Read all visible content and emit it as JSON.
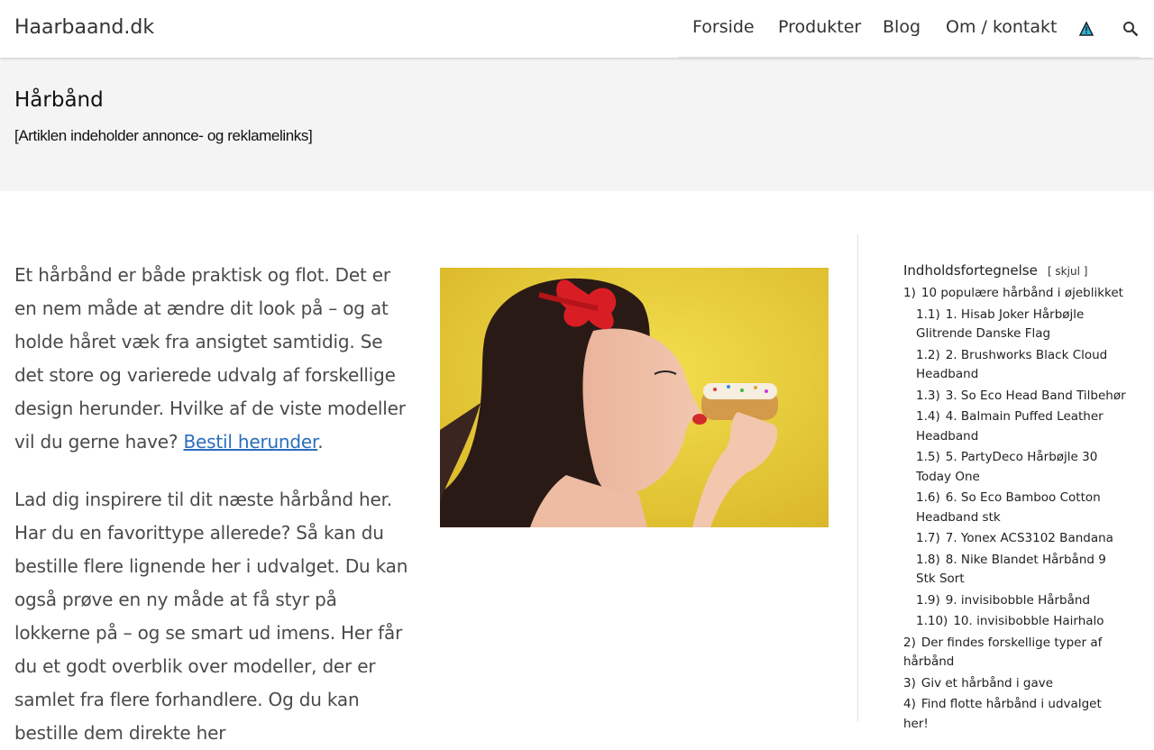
{
  "header": {
    "site_title": "Haarbaand.dk",
    "nav": [
      "Forside",
      "Produkter",
      "Blog",
      "Om / kontakt"
    ],
    "icons": {
      "alert": "warning-triangle-icon",
      "search": "search-icon"
    }
  },
  "page": {
    "title": "Hårbånd",
    "disclaimer": "[Artiklen indeholder annonce- og reklamelinks]"
  },
  "content": {
    "para1_text": "Et hårbånd er både praktisk og flot. Det er en nem måde at ændre dit look på – og at holde håret væk fra ansigtet samtidig. Se det store og varierede udvalg af forskellige design herunder. Hvilke af de viste modeller vil du gerne have? ",
    "para1_link": "Bestil herunder",
    "para1_end": ".",
    "para2": "Lad dig inspirere til dit næste hårbånd her. Har du en favorittype allerede? Så kan du bestille flere lignende her i udvalget. Du kan også prøve en ny måde at få styr på lokkerne på – og se smart ud imens. Her får du et godt overblik over modeller, der er samlet fra flere forhandlere. Og du kan bestille dem direkte her"
  },
  "toc": {
    "heading": "Indholdsfortegnelse",
    "toggle": "[ skjul ]",
    "items": [
      {
        "num": "1)",
        "text": "10 populære hårbånd i øjeblikket",
        "sub": false
      },
      {
        "num": "1.1)",
        "text": "1. Hisab Joker Hårbøjle Glitrende Danske Flag",
        "sub": true
      },
      {
        "num": "1.2)",
        "text": "2. Brushworks Black Cloud Headband",
        "sub": true
      },
      {
        "num": "1.3)",
        "text": "3. So Eco Head Band Tilbehør",
        "sub": true
      },
      {
        "num": "1.4)",
        "text": "4. Balmain Puffed Leather Headband",
        "sub": true
      },
      {
        "num": "1.5)",
        "text": "5. PartyDeco Hårbøjle 30 Today One",
        "sub": true
      },
      {
        "num": "1.6)",
        "text": "6. So Eco Bamboo Cotton Headband stk",
        "sub": true
      },
      {
        "num": "1.7)",
        "text": "7. Yonex ACS3102 Bandana",
        "sub": true
      },
      {
        "num": "1.8)",
        "text": "8. Nike Blandet Hårbånd 9 Stk Sort",
        "sub": true
      },
      {
        "num": "1.9)",
        "text": "9. invisibobble Hårbånd",
        "sub": true
      },
      {
        "num": "1.10)",
        "text": "10. invisibobble Hairhalo",
        "sub": true
      },
      {
        "num": "2)",
        "text": "Der findes forskellige typer af hårbånd",
        "sub": false
      },
      {
        "num": "3)",
        "text": "Giv et hårbånd i gave",
        "sub": false
      },
      {
        "num": "4)",
        "text": "Find flotte hårbånd i udvalget her!",
        "sub": false
      }
    ]
  },
  "colors": {
    "link": "#2a6ebb",
    "band": "#f4f4f4",
    "text": "#4a4a4a"
  }
}
